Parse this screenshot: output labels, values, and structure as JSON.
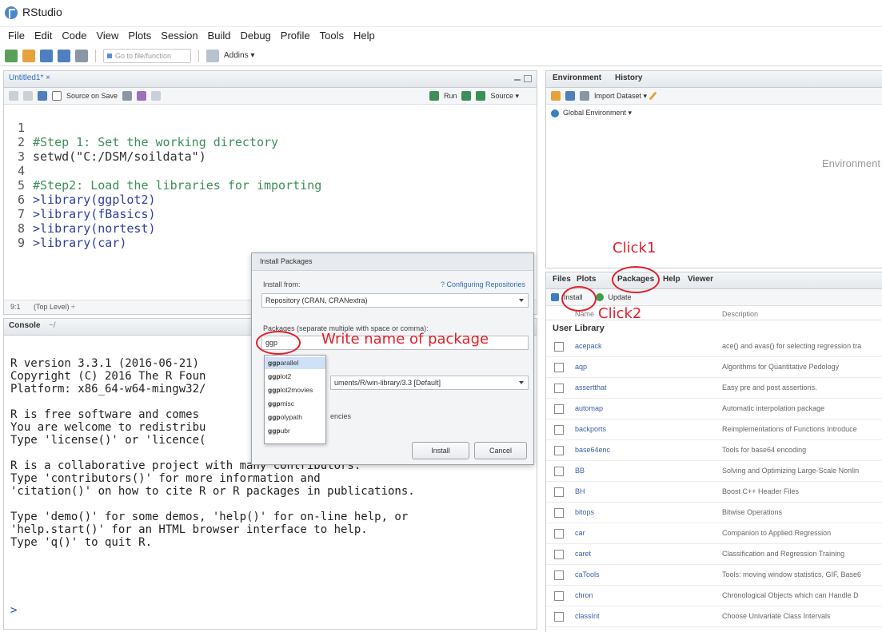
{
  "window": {
    "title": "RStudio"
  },
  "menu": [
    "File",
    "Edit",
    "Code",
    "View",
    "Plots",
    "Session",
    "Build",
    "Debug",
    "Profile",
    "Tools",
    "Help"
  ],
  "toolbar": {
    "goto_placeholder": "Go to file/function",
    "addins_label": "Addins ▾"
  },
  "editor": {
    "tab_label": "Untitled1* ×",
    "source_on_save": "Source on Save",
    "run_label": "Run",
    "source_label": "Source ▾",
    "lines": [
      {
        "n": "1",
        "text": "#Step 1: Set the working directory"
      },
      {
        "n": "2",
        "text": "setwd(\"C:/DSM/soildata\")"
      },
      {
        "n": "3",
        "text": ""
      },
      {
        "n": "4",
        "text": "#Step2: Load the libraries for importing"
      },
      {
        "n": "5",
        "text": ">library(ggplot2)"
      },
      {
        "n": "6",
        "text": ">library(fBasics)"
      },
      {
        "n": "7",
        "text": ">library(nortest)"
      },
      {
        "n": "8",
        "text": ">library(car)"
      },
      {
        "n": "9",
        "text": ""
      }
    ],
    "status_pos": "9:1",
    "status_level": "(Top Level) ÷"
  },
  "console": {
    "tab_label": "Console",
    "path_hint": "~/",
    "text": "R version 3.3.1 (2016-06-21)\nCopyright (C) 2016 The R Foun\nPlatform: x86_64-w64-mingw32/\n\nR is free software and comes\nYou are welcome to redistribu\nType 'license()' or 'licence(\n\nR is a collaborative project with many contributors.\nType 'contributors()' for more information and\n'citation()' on how to cite R or R packages in publications.\n\nType 'demo()' for some demos, 'help()' for on-line help, or\n'help.start()' for an HTML browser interface to help.\nType 'q()' to quit R.",
    "prompt": ">"
  },
  "environment": {
    "tabs": [
      "Environment",
      "History"
    ],
    "import_label": "Import Dataset ▾",
    "global_env": "Global Environment ▾",
    "empty_text": "Environment"
  },
  "files_pane": {
    "tabs": [
      "Files",
      "Plots",
      "Packages",
      "Help",
      "Viewer"
    ],
    "install_label": "Install",
    "update_label": "Update",
    "col_name": "Name",
    "col_desc": "Description",
    "user_library": "User Library",
    "packages": [
      {
        "name": "acepack",
        "desc": "ace() and avas() for selecting regression tra"
      },
      {
        "name": "aqp",
        "desc": "Algorithms for Quantitative Pedology"
      },
      {
        "name": "assertthat",
        "desc": "Easy pre and post assertions."
      },
      {
        "name": "automap",
        "desc": "Automatic interpolation package"
      },
      {
        "name": "backports",
        "desc": "Reimplementations of Functions Introduce"
      },
      {
        "name": "base64enc",
        "desc": "Tools for base64 encoding"
      },
      {
        "name": "BB",
        "desc": "Solving and Optimizing Large-Scale Nonlin"
      },
      {
        "name": "BH",
        "desc": "Boost C++ Header Files"
      },
      {
        "name": "bitops",
        "desc": "Bitwise Operations"
      },
      {
        "name": "car",
        "desc": "Companion to Applied Regression"
      },
      {
        "name": "caret",
        "desc": "Classification and Regression Training"
      },
      {
        "name": "caTools",
        "desc": "Tools: moving window statistics, GIF, Base6"
      },
      {
        "name": "chron",
        "desc": "Chronological Objects which can Handle D"
      },
      {
        "name": "classInt",
        "desc": "Choose Univariate Class Intervals"
      }
    ]
  },
  "dialog": {
    "title": "Install Packages",
    "install_from_label": "Install from:",
    "configuring_link": "? Configuring Repositories",
    "install_from_value": "Repository (CRAN, CRANextra)",
    "packages_label": "Packages (separate multiple with space or comma):",
    "packages_value": "ggp",
    "library_value": "uments/R/win-library/3.3 [Default]",
    "deps_label": "encies",
    "install_btn": "Install",
    "cancel_btn": "Cancel",
    "suggestions": [
      {
        "bold": "ggp",
        "rest": "arallel"
      },
      {
        "bold": "ggp",
        "rest": "lot2"
      },
      {
        "bold": "ggp",
        "rest": "lot2movies"
      },
      {
        "bold": "ggp",
        "rest": "misc"
      },
      {
        "bold": "ggp",
        "rest": "olypath"
      },
      {
        "bold": "ggp",
        "rest": "ubr"
      }
    ]
  },
  "annotations": {
    "click1": "Click1",
    "click2": "Click2",
    "write_name": "Write name of package",
    "color": "#e3212b"
  }
}
